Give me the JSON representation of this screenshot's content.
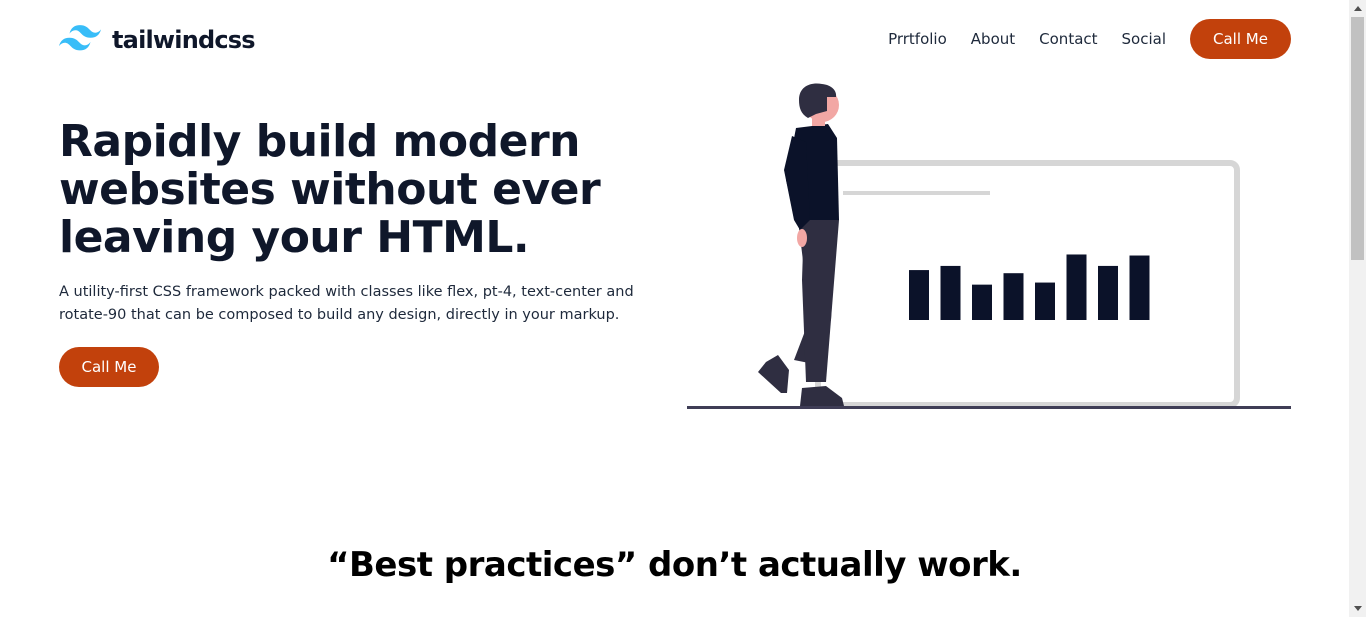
{
  "brand": {
    "name": "tailwindcss",
    "logo_icon": "tailwind-wave-logo",
    "logo_color": "#38bdf8"
  },
  "nav": {
    "links": [
      "Prrtfolio",
      "About",
      "Contact",
      "Social"
    ],
    "cta_label": "Call Me"
  },
  "hero": {
    "title": "Rapidly build modern websites without ever leaving your HTML.",
    "description": "A utility-first CSS framework packed with classes like flex, pt-4, text-center and rotate-90 that can be composed to build any design, directly in your markup.",
    "cta_label": "Call Me",
    "illustration": "person-walking-past-bar-chart-board",
    "illustration_bars": [
      0.48,
      0.52,
      0.34,
      0.45,
      0.36,
      0.63,
      0.52,
      0.62
    ]
  },
  "section": {
    "heading": "“Best practices” don’t actually work."
  },
  "colors": {
    "accent": "#c2410c",
    "text": "#0f172a",
    "illustration_dark": "#0b1229"
  }
}
